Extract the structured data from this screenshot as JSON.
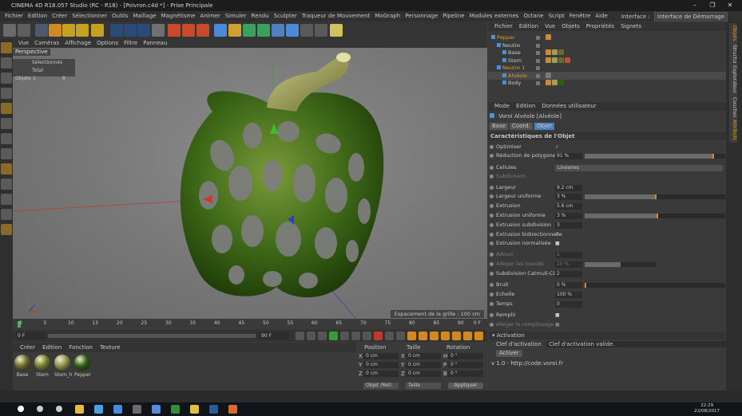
{
  "window": {
    "title": "CINEMA 4D R18.057 Studio (RC - R18) - [Poivron.c4d *] - Prise Principale"
  },
  "menubar": {
    "items": [
      "Fichier",
      "Edition",
      "Créer",
      "Sélectionner",
      "Outils",
      "Maillage",
      "Magnétisme",
      "Animer",
      "Simuler",
      "Rendu",
      "Sculpter",
      "Traqueur de Mouvement",
      "MoGraph",
      "Personnage",
      "Pipeline",
      "Modules externes",
      "Octane",
      "Script",
      "Fenêtre",
      "Aide"
    ],
    "interface_label": "Interface :",
    "interface_value": "Interface de Démarrage"
  },
  "viewport": {
    "menu": [
      "Vue",
      "Caméras",
      "Affichage",
      "Options",
      "Filtre",
      "Panneau"
    ],
    "label": "Perspective",
    "stats": {
      "header": "Sélectionnés Total",
      "row_label": "Objets",
      "selected": "1",
      "total": "8"
    },
    "grid_spacing": "Espacement de la grille : 100 cm"
  },
  "timeline": {
    "ticks": [
      "0",
      "5",
      "10",
      "15",
      "20",
      "25",
      "30",
      "35",
      "40",
      "45",
      "50",
      "55",
      "60",
      "65",
      "70",
      "75",
      "80",
      "85",
      "90"
    ],
    "end_label": "0 F"
  },
  "transport": {
    "current": "0 F",
    "end": "90 F"
  },
  "materials": {
    "menu": [
      "Créer",
      "Edition",
      "Fonction",
      "Texture"
    ],
    "items": [
      {
        "name": "Base",
        "color": "#6a6a2a"
      },
      {
        "name": "Stem",
        "color": "#707a2c"
      },
      {
        "name": "Stem_h",
        "color": "#8a8e4a"
      },
      {
        "name": "Pepper",
        "color": "#2c5d12"
      }
    ]
  },
  "coordinates": {
    "headers": [
      "Position",
      "Taille",
      "Rotation"
    ],
    "rows": [
      {
        "axis": "X",
        "pos": "0 cm",
        "size": "0 cm",
        "rot_axis": "H",
        "rot": "0 °"
      },
      {
        "axis": "Y",
        "pos": "0 cm",
        "size": "0 cm",
        "rot_axis": "P",
        "rot": "0 °"
      },
      {
        "axis": "Z",
        "pos": "0 cm",
        "size": "0 cm",
        "rot_axis": "B",
        "rot": "0 °"
      }
    ],
    "mode_select": "Objet (Rel)",
    "size_select": "Taille",
    "apply": "Appliquer"
  },
  "object_manager": {
    "menu": [
      "Fichier",
      "Edition",
      "Vue",
      "Objets",
      "Propriétés",
      "Signets"
    ],
    "objects": [
      {
        "name": "Pepper",
        "indent": 0,
        "color": "#e59a2a"
      },
      {
        "name": "Neutre",
        "indent": 1,
        "color": "#c8c8c8"
      },
      {
        "name": "Base",
        "indent": 2,
        "color": "#c8c8c8"
      },
      {
        "name": "Stem",
        "indent": 2,
        "color": "#c8c8c8"
      },
      {
        "name": "Neutre 1",
        "indent": 1,
        "color": "#e59a2a"
      },
      {
        "name": "Alvéole",
        "indent": 2,
        "color": "#e59a2a"
      },
      {
        "name": "Body",
        "indent": 2,
        "color": "#c8c8c8"
      }
    ]
  },
  "attribute_manager": {
    "menu": [
      "Mode",
      "Edition",
      "Données utilisateur"
    ],
    "object_title": "Voroi Alvéole [Alvéole]",
    "tabs": [
      "Base",
      "Coord.",
      "Objet"
    ],
    "section": "Caractéristiques de l'Objet",
    "rows": [
      {
        "label": "Optimiser",
        "check": "✓"
      },
      {
        "label": "Réduction de polygones",
        "value": "91 %",
        "fill": 0.91
      },
      {
        "label": "Cellules",
        "select": "Linéaires"
      },
      {
        "label": "Subdivision",
        "dim": true
      },
      {
        "label": "Largeur",
        "value": "9.2 cm"
      },
      {
        "label": "Largeur uniforme",
        "value": "3 %",
        "fill": 0.5
      },
      {
        "label": "Extrusion",
        "value": "5.6 cm"
      },
      {
        "label": "Extrusion uniforme",
        "value": "3 %",
        "fill": 0.51
      },
      {
        "label": "Extrusion subdivision",
        "value": "3"
      },
      {
        "label": "Extrusion bidirectionnelle",
        "check": "✓"
      },
      {
        "label": "Extrusion normalisée",
        "check": "■"
      },
      {
        "label": "Adouci",
        "value": "1",
        "dim": true
      },
      {
        "label": "Alléger les noeuds",
        "value": "10 %",
        "dim": true,
        "fill": 0.5
      },
      {
        "label": "Subdivision Catmull-Clark",
        "value": "2"
      },
      {
        "label": "Bruit",
        "value": "0 %",
        "fill": 0.0
      },
      {
        "label": "Echelle",
        "value": "100 %"
      },
      {
        "label": "Temps",
        "value": "0"
      },
      {
        "label": "Remplir",
        "check": "■"
      },
      {
        "label": "Alléger le remplissage",
        "check": "■",
        "dim": true
      }
    ],
    "activation_header": "Activation",
    "activation_label": "Clef d'activation",
    "activation_value": "Clef d'activation valide.",
    "activate_button": "Activer",
    "version": "v 1.0 - http://code.voroi.fr"
  },
  "right_tabs": [
    "Objets",
    "Structure",
    "Explorateur",
    "Couches",
    "Attributs"
  ],
  "taskbar": {
    "time": "22:29",
    "date": "22/08/2017"
  }
}
